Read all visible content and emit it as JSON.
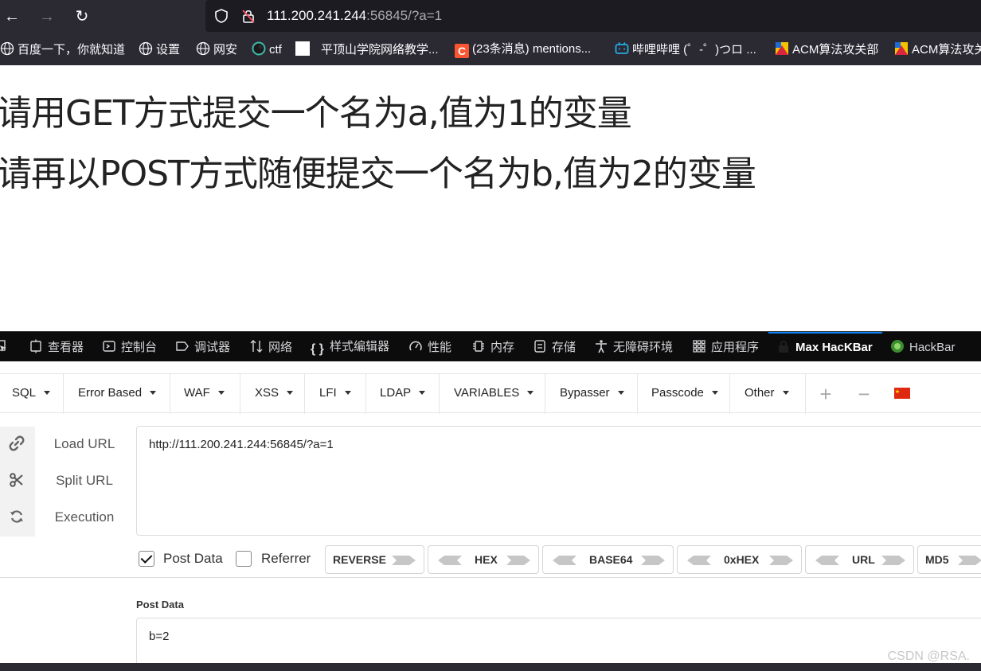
{
  "browser": {
    "url_host": "111.200.241.244",
    "url_rest": ":56845/?a=1"
  },
  "bookmarks": [
    "百度一下，你就知道",
    "设置",
    "网安",
    "ctf",
    "平顶山学院网络教学...",
    "(23条消息) mentions...",
    "哔哩哔哩 (゜-゜)つロ ...",
    "ACM算法攻关部",
    "ACM算法攻关部"
  ],
  "page": {
    "line1": "请用GET方式提交一个名为a,值为1的变量",
    "line2": "请再以POST方式随便提交一个名为b,值为2的变量"
  },
  "devtools": {
    "tabs": [
      "查看器",
      "控制台",
      "调试器",
      "网络",
      "样式编辑器",
      "性能",
      "内存",
      "存储",
      "无障碍环境",
      "应用程序",
      "Max HacKBar",
      "HackBar"
    ],
    "active_tab": "Max HacKBar"
  },
  "hackbar": {
    "menus": [
      "SQL",
      "Error Based",
      "WAF",
      "XSS",
      "LFI",
      "LDAP",
      "VARIABLES",
      "Bypasser",
      "Passcode",
      "Other"
    ],
    "actions": [
      "Load URL",
      "Split URL",
      "Execution"
    ],
    "url_value": "http://111.200.241.244:56845/?a=1",
    "options": {
      "post_data_label": "Post Data",
      "post_data_checked": true,
      "referrer_label": "Referrer",
      "referrer_checked": false
    },
    "encoders": [
      "REVERSE",
      "HEX",
      "BASE64",
      "0xHEX",
      "URL",
      "MD5"
    ],
    "post_title": "Post Data",
    "post_value": "b=2"
  },
  "watermark": "CSDN @RSA.",
  "colors": {
    "chrome_bg": "#2b2a33",
    "devtools_bg": "#0c0c0d",
    "accent": "#0a84ff"
  }
}
